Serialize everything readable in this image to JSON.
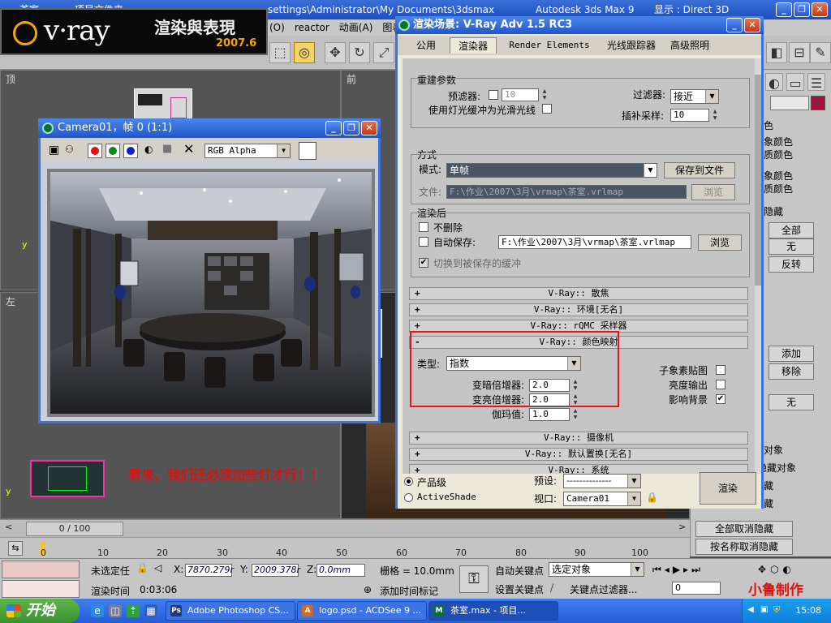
{
  "max_window": {
    "title_left": "茶室",
    "title_mid": "项目文件夹",
    "title_path": "settings\\Administrator\\My Documents\\3dsmax",
    "title_app": "Autodesk 3ds Max 9",
    "title_display": "显示 : Direct 3D",
    "menu": [
      "(O)",
      "reactor",
      "动画(A)",
      "图表编"
    ],
    "viewport_labels": {
      "top": "顶",
      "front": "前",
      "left": "左"
    }
  },
  "logo": {
    "brand": "v·ray",
    "title": "渲染與表現",
    "date": "2007.6"
  },
  "overlay_note": "看来，我们还必须加些灯才行！！",
  "camera_window": {
    "title": "Camera01，帧 0 (1:1)",
    "channel": "RGB Alpha",
    "swatches": [
      {
        "name": "red-channel",
        "color": "#e01010"
      },
      {
        "name": "green-channel",
        "color": "#0a8a1a"
      },
      {
        "name": "blue-channel",
        "color": "#1020c8"
      }
    ]
  },
  "render_dialog": {
    "title": "渲染场景: V-Ray Adv 1.5 RC3",
    "tabs": [
      "公用",
      "渲染器",
      "Render Elements",
      "光线跟踪器",
      "高级照明"
    ],
    "active_tab": 1,
    "rebuild": {
      "title": "重建参数",
      "prefilter_label": "预滤器:",
      "prefilter_value": "10",
      "use_light_cache_label": "使用灯光缓冲为光滑光线",
      "filter_label": "过滤器:",
      "filter_value": "接近",
      "interp_label": "插补采样:",
      "interp_value": "10"
    },
    "mode": {
      "title": "方式",
      "mode_label": "模式:",
      "mode_value": "单帧",
      "save_button": "保存到文件",
      "file_label": "文件:",
      "file_value": "F:\\作业\\2007\\3月\\vrmap\\茶室.vrlmap",
      "browse": "浏览"
    },
    "after_render": {
      "title": "渲染后",
      "dont_delete": "不删除",
      "auto_save": "自动保存:",
      "auto_save_path": "F:\\作业\\2007\\3月\\vrmap\\茶室.vrlmap",
      "browse": "浏览",
      "switch_label": "切换到被保存的缓冲"
    },
    "rollouts_top": [
      {
        "sign": "+",
        "label": "V-Ray:: 散焦"
      },
      {
        "sign": "+",
        "label": "V-Ray:: 环境[无名]"
      },
      {
        "sign": "+",
        "label": "V-Ray:: rQMC 采样器"
      },
      {
        "sign": "-",
        "label": "V-Ray:: 颜色映射"
      }
    ],
    "color_mapping": {
      "type_label": "类型:",
      "type_value": "指数",
      "dark_label": "变暗倍增器:",
      "dark_value": "2.0",
      "bright_label": "变亮倍增器:",
      "bright_value": "2.0",
      "gamma_label": "伽玛值:",
      "gamma_value": "1.0",
      "subpixel_label": "子象素贴图",
      "clamp_label": "亮度输出",
      "affect_bg_label": "影响背景",
      "affect_bg_checked": "✔"
    },
    "rollouts_bottom": [
      {
        "sign": "+",
        "label": "V-Ray:: 摄像机"
      },
      {
        "sign": "+",
        "label": "V-Ray:: 默认置换[无名]"
      },
      {
        "sign": "+",
        "label": "V-Ray:: 系统"
      }
    ],
    "bottom": {
      "production": "产品级",
      "activeshade": "ActiveShade",
      "preset_label": "预设:",
      "preset_value": "--------------",
      "viewport_label": "视口:",
      "viewport_value": "Camera01",
      "render_button": "渲染"
    }
  },
  "command_panel": {
    "items": [
      "色",
      "象颜色",
      "质颜色",
      "象颜色",
      "质颜色",
      "隐藏",
      "全部",
      "无",
      "反转",
      "添加",
      "移除",
      "无",
      "对象",
      "隐藏对象",
      "藏",
      "藏",
      "全部取消隐藏",
      "按名称取消隐藏"
    ]
  },
  "timeline": {
    "slider": "0 / 100",
    "ticks": [
      "0",
      "10",
      "20",
      "30",
      "40",
      "50",
      "60",
      "70",
      "80",
      "90",
      "100"
    ]
  },
  "status": {
    "selection": "未选定任",
    "x_label": "X:",
    "x_value": "7870.279r",
    "y_label": "Y:",
    "y_value": "2009.378r",
    "z_label": "Z:",
    "z_value": "0.0mm",
    "grid": "栅格 = 10.0mm",
    "auto_key": "自动关键点",
    "selected": "选定对象",
    "render_time_label": "渲染时间",
    "render_time": "0:03:06",
    "add_time_tag": "添加时间标记",
    "set_key": "设置关键点",
    "key_filter": "关键点过滤器...",
    "frame": "0",
    "watermark": "小鲁制作"
  },
  "taskbar": {
    "start": "开始",
    "tasks": [
      {
        "label": "Adobe Photoshop CS...",
        "icon": "Ps",
        "color": "#1f3a7a"
      },
      {
        "label": "logo.psd - ACDSee 9 ...",
        "icon": "A",
        "color": "#d2691e"
      },
      {
        "label": "茶室.max - 项目...",
        "icon": "M",
        "color": "#0f6d3a"
      }
    ],
    "clock": "15:08"
  }
}
